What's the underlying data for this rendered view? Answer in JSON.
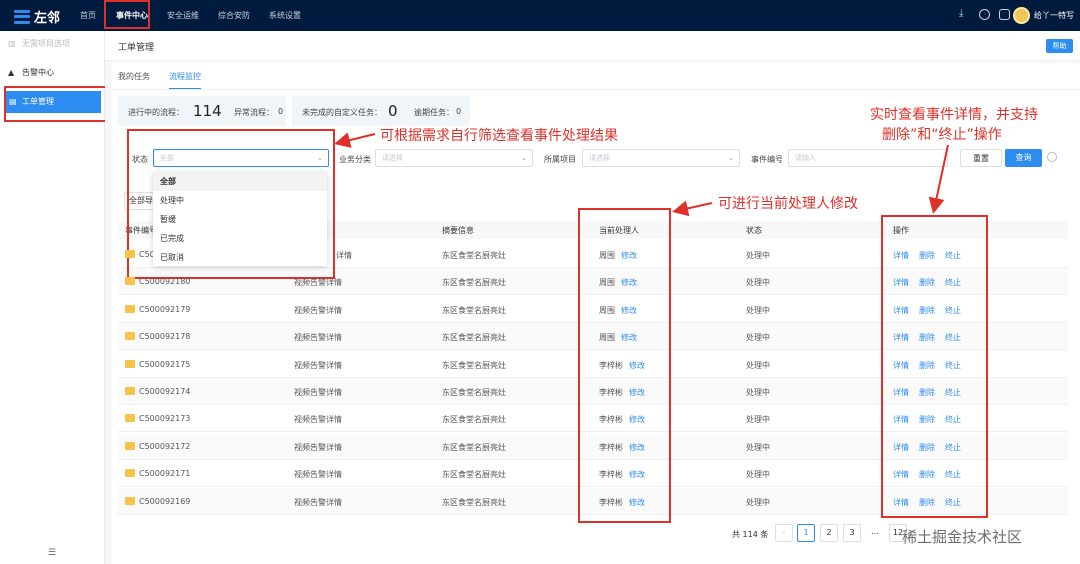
{
  "app": {
    "logo": "左邻"
  },
  "nav": [
    "首页",
    "事件中心",
    "安全运维",
    "综合安防",
    "系统设置"
  ],
  "user": {
    "name": "给丫一特写"
  },
  "sidebar": {
    "top": "无需项目选项",
    "items": [
      "告警中心",
      "工单管理"
    ]
  },
  "page": {
    "title": "工单管理",
    "help": "帮助"
  },
  "tabs": [
    "我的任务",
    "流程监控"
  ],
  "stats": [
    {
      "label": "进行中的流程：",
      "value": "114"
    },
    {
      "label": "异常流程：",
      "value": "0"
    },
    {
      "label": "未完成的自定义任务：",
      "value": "0"
    },
    {
      "label": "逾期任务：",
      "value": "0"
    }
  ],
  "filters": {
    "status_label": "状态",
    "status_placeholder": "全部",
    "category_label": "业务分类",
    "category_placeholder": "请选择",
    "project_label": "所属项目",
    "project_placeholder": "请选择",
    "event_no_label": "事件编号",
    "event_no_placeholder": "请输入",
    "reset": "重置",
    "search": "查询"
  },
  "dropdown": [
    "全部",
    "处理中",
    "暂缓",
    "已完成",
    "已取消"
  ],
  "all_button": "全部导",
  "table": {
    "headers": [
      "事件编号",
      "摘要信息",
      "当前处理人",
      "状态",
      "操作"
    ],
    "rows": [
      {
        "id": "C50",
        "summary": "详情",
        "loc": "东区食堂名厨亮灶",
        "handler": "周围",
        "edit": "修改",
        "status": "处理中"
      },
      {
        "id": "C500092180",
        "summary": "视频告警详情",
        "loc": "东区食堂名厨亮灶",
        "handler": "周围",
        "edit": "修改",
        "status": "处理中"
      },
      {
        "id": "C500092179",
        "summary": "视频告警详情",
        "loc": "东区食堂名厨亮灶",
        "handler": "周围",
        "edit": "修改",
        "status": "处理中"
      },
      {
        "id": "C500092178",
        "summary": "视频告警详情",
        "loc": "东区食堂名厨亮灶",
        "handler": "周围",
        "edit": "修改",
        "status": "处理中"
      },
      {
        "id": "C500092175",
        "summary": "视频告警详情",
        "loc": "东区食堂名厨亮灶",
        "handler": "李梓彬",
        "edit": "修改",
        "status": "处理中"
      },
      {
        "id": "C500092174",
        "summary": "视频告警详情",
        "loc": "东区食堂名厨亮灶",
        "handler": "李梓彬",
        "edit": "修改",
        "status": "处理中"
      },
      {
        "id": "C500092173",
        "summary": "视频告警详情",
        "loc": "东区食堂名厨亮灶",
        "handler": "李梓彬",
        "edit": "修改",
        "status": "处理中"
      },
      {
        "id": "C500092172",
        "summary": "视频告警详情",
        "loc": "东区食堂名厨亮灶",
        "handler": "李梓彬",
        "edit": "修改",
        "status": "处理中"
      },
      {
        "id": "C500092171",
        "summary": "视频告警详情",
        "loc": "东区食堂名厨亮灶",
        "handler": "李梓彬",
        "edit": "修改",
        "status": "处理中"
      },
      {
        "id": "C500092169",
        "summary": "视频告警详情",
        "loc": "东区食堂名厨亮灶",
        "handler": "李梓彬",
        "edit": "修改",
        "status": "处理中"
      }
    ],
    "actions": [
      "详情",
      "删除",
      "终止"
    ]
  },
  "pager": {
    "total": "共 114 条",
    "pages": [
      "1",
      "2",
      "3",
      "…",
      "12"
    ]
  },
  "annotations": {
    "a1": "可根据需求自行筛选查看事件处理结果",
    "a2": "可进行当前处理人修改",
    "a3_line1": "实时查看事件详情，并支持",
    "a3_line2": "删除”和“终止”操作"
  },
  "watermark": "稀土掘金技术社区",
  "colors": {
    "accent": "#2d8cf0",
    "topbar": "#001b3d",
    "annotation": "#e0302a"
  }
}
